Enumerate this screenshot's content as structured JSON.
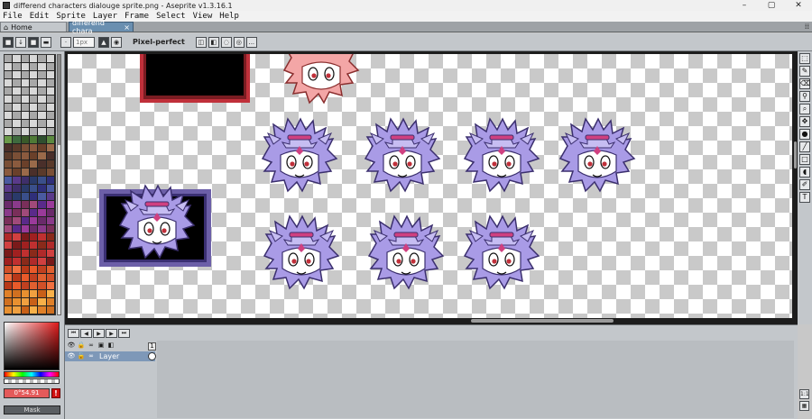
{
  "window": {
    "title": "differend characters dialouge sprite.png - Aseprite v1.3.16.1",
    "controls": [
      "–",
      "▢",
      "✕"
    ]
  },
  "menu": [
    "File",
    "Edit",
    "Sprite",
    "Layer",
    "Frame",
    "Select",
    "View",
    "Help"
  ],
  "tabs": {
    "home_label": "Home",
    "doc_label": "differend chara",
    "doc_close": "×",
    "grip": "⁞⁞"
  },
  "toolbar": {
    "brush_size": "1px",
    "pixel_perfect_label": "Pixel-perfect",
    "more_label": "..."
  },
  "color_bar": {
    "fg_label": "0°54.91",
    "warning": "!",
    "bg_label": "Mask"
  },
  "timeline": {
    "frame_number": "1",
    "layer_name": "Layer"
  },
  "colors": {
    "canvas_bg": "#1d1d1d",
    "panel_bg": "#c3c7cb",
    "blaze_purple": "#a99be6",
    "blaze_pink": "#f3a6a6",
    "accent_red": "#c0303a",
    "frame_purple": "#6c5fa8"
  },
  "tool_icons": [
    "marquee-icon",
    "pencil-icon",
    "eraser-icon",
    "eyedropper-icon",
    "zoom-icon",
    "move-icon",
    "fill-icon",
    "line-icon",
    "rectangle-icon",
    "ellipse-icon",
    "contour-icon",
    "text-icon"
  ]
}
